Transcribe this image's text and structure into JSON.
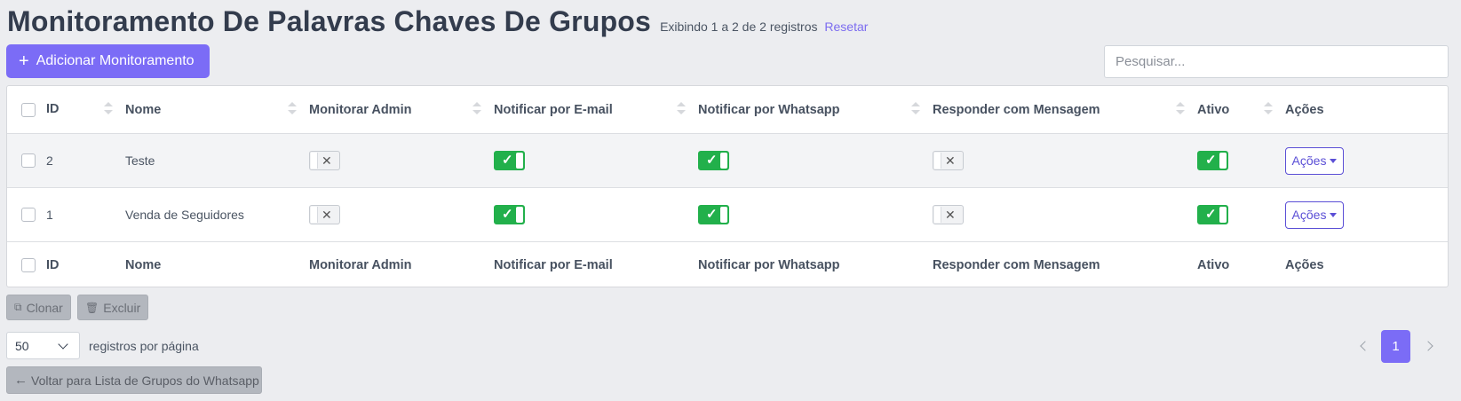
{
  "header": {
    "title": "Monitoramento De Palavras Chaves De Grupos",
    "records_info": "Exibindo 1 a 2 de 2 registros",
    "reset_link": "Resetar"
  },
  "toolbar": {
    "add_button": "Adicionar Monitoramento",
    "search_placeholder": "Pesquisar..."
  },
  "table": {
    "columns": [
      "ID",
      "Nome",
      "Monitorar Admin",
      "Notificar por E-mail",
      "Notificar por Whatsapp",
      "Responder com Mensagem",
      "Ativo",
      "Ações"
    ],
    "rows": [
      {
        "id": "2",
        "nome": "Teste",
        "monitorar_admin": false,
        "notificar_email": true,
        "notificar_whatsapp": true,
        "responder_mensagem": false,
        "ativo": true,
        "acoes": "Ações"
      },
      {
        "id": "1",
        "nome": "Venda de Seguidores",
        "monitorar_admin": false,
        "notificar_email": true,
        "notificar_whatsapp": true,
        "responder_mensagem": false,
        "ativo": true,
        "acoes": "Ações"
      }
    ]
  },
  "bulk_actions": {
    "clone": "Clonar",
    "delete": "Excluir"
  },
  "pagination": {
    "per_page_value": "50",
    "per_page_label": "registros por página",
    "current_page": "1"
  },
  "back_button": "Voltar para Lista de Grupos do Whatsapp",
  "colors": {
    "primary": "#7b6cf6",
    "toggle_on": "#22b04b",
    "title": "#333c4d"
  }
}
